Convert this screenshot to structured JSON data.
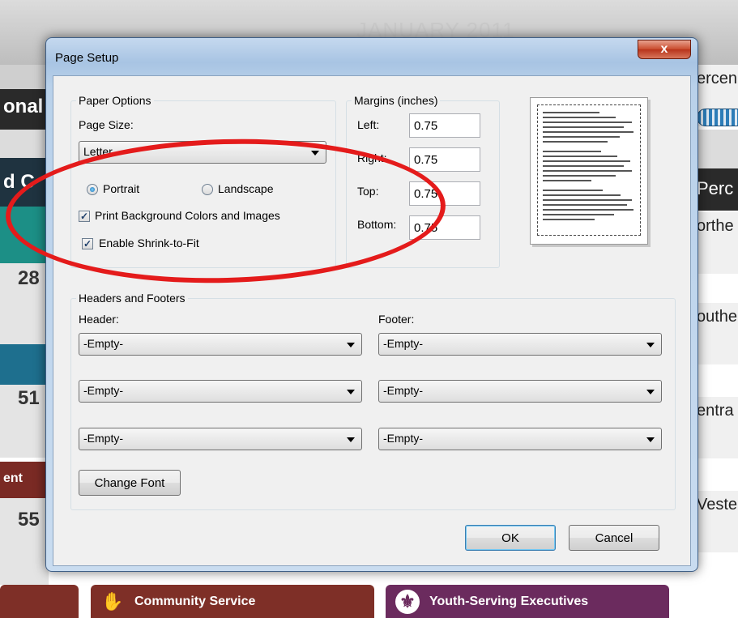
{
  "background": {
    "month": "JANUARY 2011",
    "left_fragments": [
      "onal",
      "d C",
      "ent"
    ],
    "numbers": [
      "28",
      "51",
      "55"
    ],
    "right_labels": [
      "ercen",
      "Perc",
      "orthe",
      "outhe",
      "entra",
      "Veste"
    ],
    "bottom_tabs": [
      {
        "label": "Community Service",
        "icon": "hand-icon"
      },
      {
        "label": "Youth-Serving Executives",
        "icon": "fleur-de-lis-icon"
      }
    ]
  },
  "dialog": {
    "title": "Page Setup",
    "close_label": "x",
    "paper_options": {
      "group_title": "Paper Options",
      "page_size_label": "Page Size:",
      "page_size_value": "Letter",
      "orientation": [
        {
          "label": "Portrait",
          "selected": true
        },
        {
          "label": "Landscape",
          "selected": false
        }
      ],
      "print_background_label": "Print Background Colors and Images",
      "print_background_checked": true,
      "shrink_label": "Enable Shrink-to-Fit",
      "shrink_checked": true
    },
    "margins": {
      "group_title": "Margins (inches)",
      "left_label": "Left:",
      "left_value": "0.75",
      "right_label": "Right:",
      "right_value": "0.75",
      "top_label": "Top:",
      "top_value": "0.75",
      "bottom_label": "Bottom:",
      "bottom_value": "0.75"
    },
    "headers_footers": {
      "group_title": "Headers and Footers",
      "header_label": "Header:",
      "footer_label": "Footer:",
      "header_values": [
        "-Empty-",
        "-Empty-",
        "-Empty-"
      ],
      "footer_values": [
        "-Empty-",
        "-Empty-",
        "-Empty-"
      ],
      "change_font_label": "Change Font"
    },
    "ok_label": "OK",
    "cancel_label": "Cancel"
  },
  "colors": {
    "annotation": "#e41b1b",
    "titlebar": "#a8c4e3",
    "close_button": "#c94a2c"
  }
}
